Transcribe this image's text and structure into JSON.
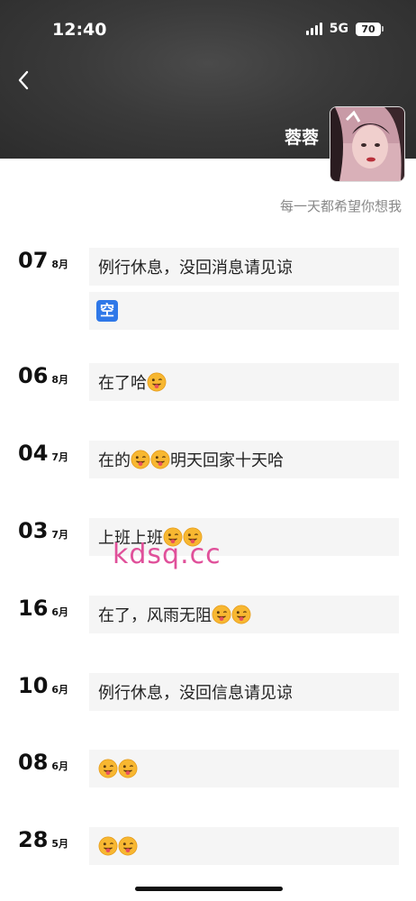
{
  "status": {
    "time": "12:40",
    "network": "5G",
    "battery": "70"
  },
  "profile": {
    "nickname": "蓉蓉",
    "signature": "每一天都希望你想我"
  },
  "posts": [
    {
      "day": "07",
      "month": "8月",
      "text": "例行休息，没回消息请见谅",
      "extra": "空"
    },
    {
      "day": "06",
      "month": "8月",
      "text": "在了哈"
    },
    {
      "day": "04",
      "month": "7月",
      "text": "在的",
      "text2": "明天回家十天哈"
    },
    {
      "day": "03",
      "month": "7月",
      "text": "上班上班"
    },
    {
      "day": "16",
      "month": "6月",
      "text": "在了，风雨无阻"
    },
    {
      "day": "10",
      "month": "6月",
      "text": "例行休息，没回信息请见谅"
    },
    {
      "day": "08",
      "month": "6月",
      "text": ""
    },
    {
      "day": "28",
      "month": "5月",
      "text": ""
    }
  ],
  "watermark": "kdsq.cc",
  "icons": {
    "back": "chevron-left-icon",
    "emoji": "winking-tongue-emoji-icon"
  }
}
